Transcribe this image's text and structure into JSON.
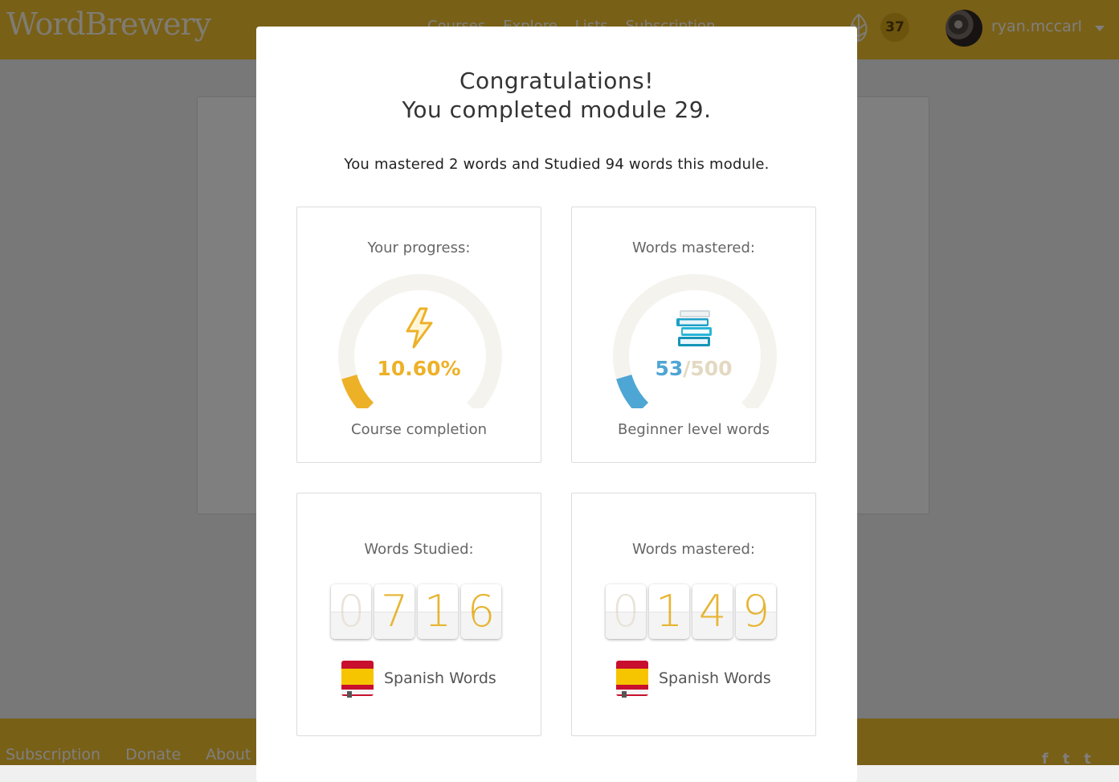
{
  "app": {
    "logo": "WordBrewery",
    "nav": [
      "Courses",
      "Explore",
      "Lists",
      "Subscription"
    ],
    "coins": "37",
    "username": "ryan.mccarl"
  },
  "footer": {
    "links": [
      "Subscription",
      "Donate",
      "About"
    ],
    "social": [
      "facebook-icon",
      "twitter-icon",
      "tumblr-icon"
    ]
  },
  "modal": {
    "title_line1": "Congratulations!",
    "title_line2": "You completed module 29.",
    "subtitle": "You mastered 2 words and Studied 94 words this module.",
    "progress_card": {
      "title": "Your progress:",
      "percent_text": "10.60%",
      "percent": 10.6,
      "caption": "Course completion",
      "icon": "lightning-icon",
      "color": "#edb128"
    },
    "mastered_gauge_card": {
      "title": "Words mastered:",
      "current": "53",
      "separator": "/",
      "total": "500",
      "caption": "Beginner level words",
      "icon": "books-icon",
      "color": "#4ea6d4"
    },
    "studied_counter_card": {
      "title": "Words Studied:",
      "digits": [
        "0",
        "7",
        "1",
        "6"
      ],
      "label": "Spanish Words"
    },
    "mastered_counter_card": {
      "title": "Words mastered:",
      "digits": [
        "0",
        "1",
        "4",
        "9"
      ],
      "label": "Spanish Words"
    }
  }
}
